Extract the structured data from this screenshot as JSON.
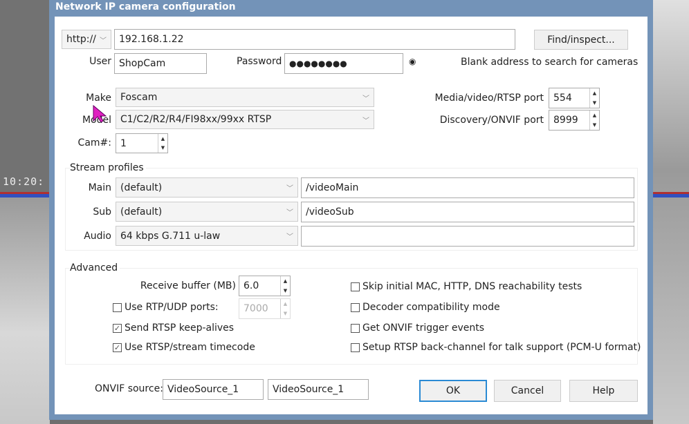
{
  "window": {
    "title": "Network IP camera configuration"
  },
  "background": {
    "clock": "10:20:"
  },
  "address": {
    "scheme": "http://",
    "value": "192.168.1.22",
    "find_label": "Find/inspect...",
    "hint": "Blank address to search for cameras"
  },
  "auth": {
    "user_label": "User",
    "user": "ShopCam",
    "password_label": "Password",
    "password": "●●●●●●●●"
  },
  "camera": {
    "make_label": "Make",
    "make": "Foscam",
    "model_label": "Model",
    "model": "C1/C2/R2/R4/FI98xx/99xx RTSP",
    "cam_label": "Cam#:",
    "cam": "1"
  },
  "ports": {
    "media_label": "Media/video/RTSP port",
    "media": "554",
    "discovery_label": "Discovery/ONVIF port",
    "discovery": "8999"
  },
  "streams": {
    "title": "Stream profiles",
    "main": {
      "label": "Main",
      "profile": "(default)",
      "path": "/videoMain"
    },
    "sub": {
      "label": "Sub",
      "profile": "(default)",
      "path": "/videoSub"
    },
    "audio": {
      "label": "Audio",
      "profile": "64 kbps G.711 u-law",
      "path": ""
    }
  },
  "advanced": {
    "title": "Advanced",
    "buffer_label": "Receive buffer (MB)",
    "buffer": "6.0",
    "rtp_label": "Use RTP/UDP ports:",
    "rtp_checked": false,
    "rtp_port": "7000",
    "keepalive_label": "Send RTSP keep-alives",
    "keepalive_checked": true,
    "timecode_label": "Use RTSP/stream timecode",
    "timecode_checked": true,
    "skip_label": "Skip initial MAC, HTTP, DNS reachability tests",
    "skip_checked": false,
    "decoder_label": "Decoder compatibility mode",
    "decoder_checked": false,
    "onvif_events_label": "Get ONVIF trigger events",
    "onvif_events_checked": false,
    "backchannel_label": "Setup RTSP back-channel for talk support (PCM-U format)",
    "backchannel_checked": false
  },
  "onvif": {
    "label": "ONVIF source:",
    "source1": "VideoSource_1",
    "source2": "VideoSource_1"
  },
  "buttons": {
    "ok": "OK",
    "cancel": "Cancel",
    "help": "Help"
  }
}
